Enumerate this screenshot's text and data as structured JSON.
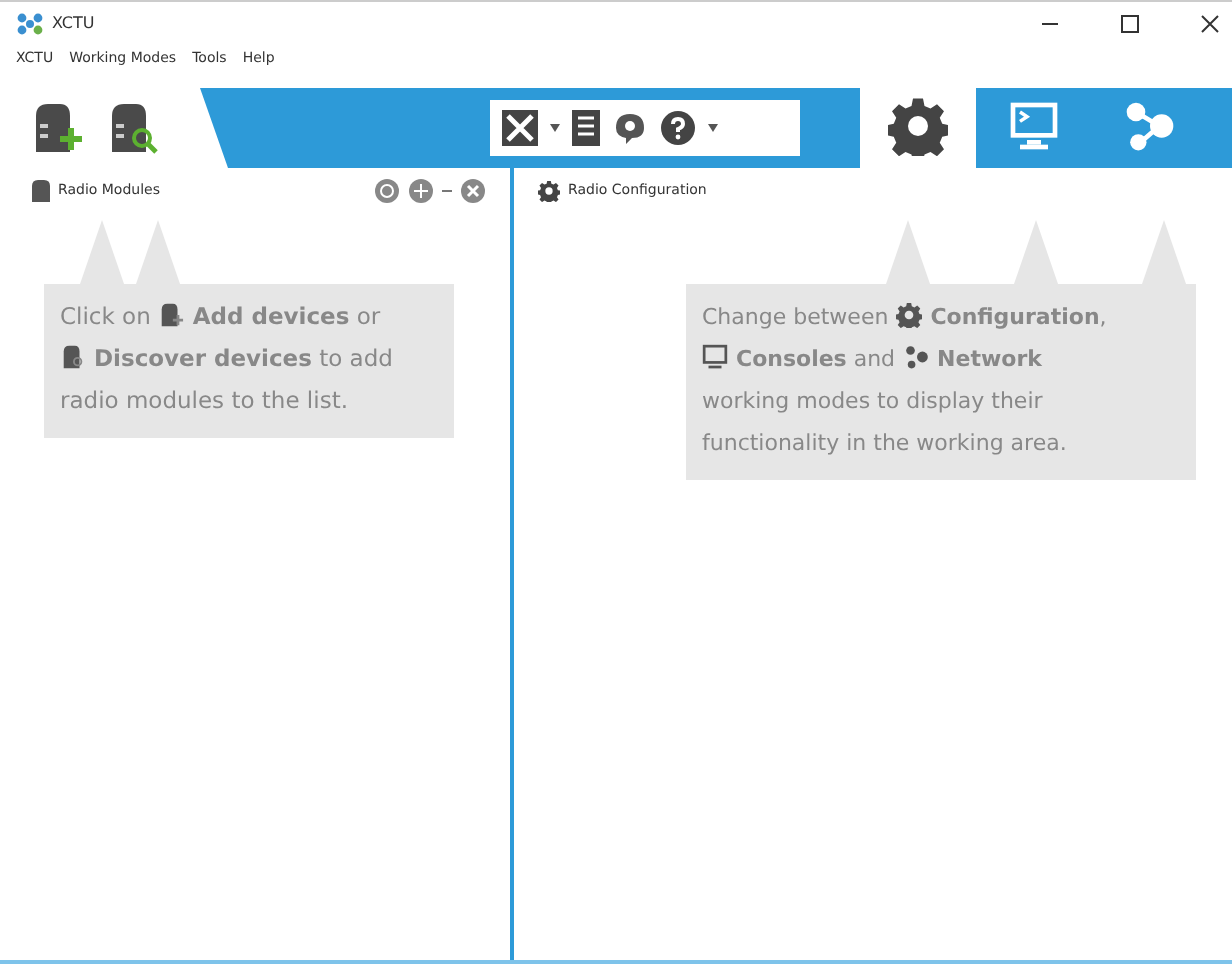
{
  "window": {
    "title": "XCTU"
  },
  "menu": [
    "XCTU",
    "Working Modes",
    "Tools",
    "Help"
  ],
  "modes": [
    {
      "kind": "configuration",
      "selected": true
    },
    {
      "kind": "consoles",
      "selected": false
    },
    {
      "kind": "network",
      "selected": false
    }
  ],
  "left_panel": {
    "title": "Radio Modules",
    "hint": [
      [
        {
          "kind": "text",
          "text": "Click on"
        },
        {
          "kind": "add"
        },
        {
          "kind": "text",
          "text": "**Add devices** or"
        }
      ],
      [
        {
          "kind": "discover"
        },
        {
          "kind": "text",
          "text": "**Discover devices** to add"
        }
      ],
      [
        {
          "kind": "text",
          "text": "radio modules to the list."
        }
      ]
    ]
  },
  "right_panel": {
    "title": "Radio Configuration",
    "hint": [
      [
        {
          "kind": "text",
          "text": "Change between"
        },
        {
          "kind": "configuration"
        },
        {
          "kind": "text",
          "text": "**Configuration**,"
        }
      ],
      [
        {
          "kind": "consoles"
        },
        {
          "kind": "text",
          "text": "**Consoles** and"
        },
        {
          "kind": "network"
        },
        {
          "kind": "text",
          "text": "**Network**"
        }
      ],
      [
        {
          "kind": "text",
          "text": "working modes to display their"
        }
      ],
      [
        {
          "kind": "text",
          "text": "functionality in the working area."
        }
      ]
    ]
  }
}
